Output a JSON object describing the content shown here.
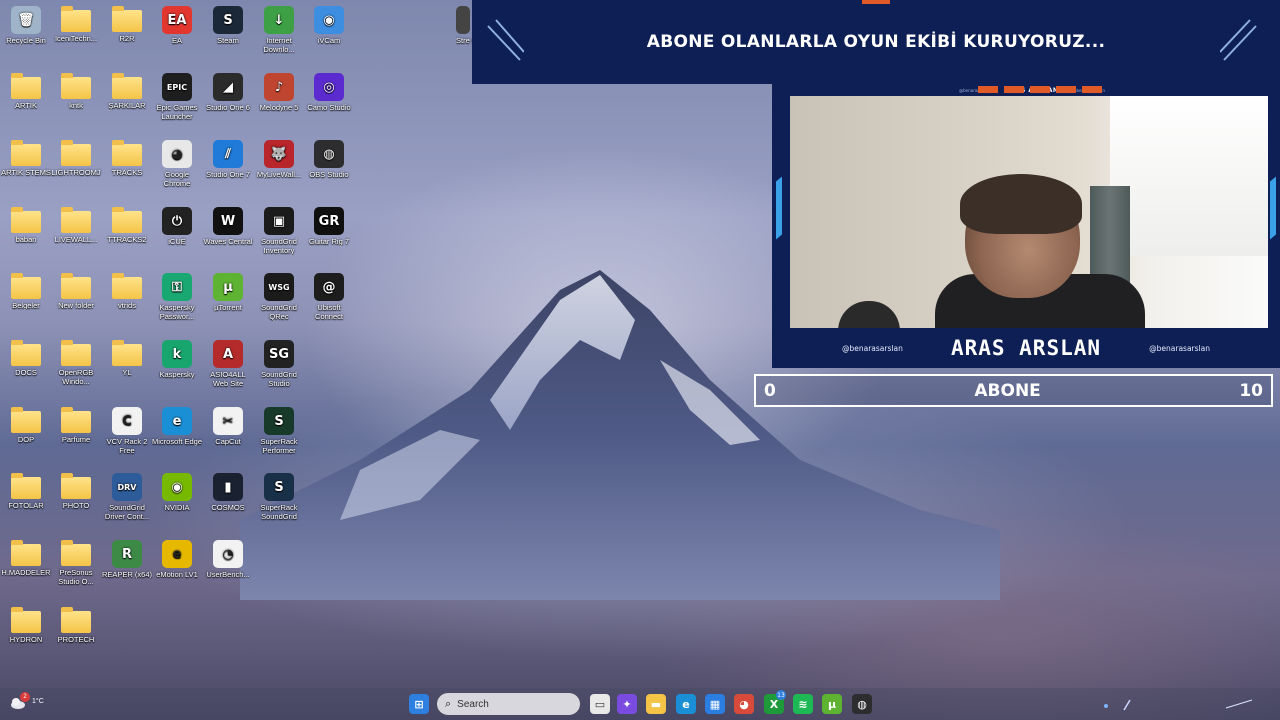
{
  "desktop": {
    "icons": [
      {
        "label": "Recycle Bin",
        "icon": "recycle-bin-icon",
        "color": "#9fb4c8",
        "glyph": "🗑",
        "col": 0,
        "row": 0
      },
      {
        "label": "IceniTechn...",
        "icon": "folder-icon",
        "folder": true,
        "col": 1,
        "row": 0
      },
      {
        "label": "R2R",
        "icon": "folder-icon",
        "folder": true,
        "col": 2,
        "row": 0
      },
      {
        "label": "EA",
        "icon": "ea-icon",
        "color": "#e2372f",
        "glyph": "EA",
        "col": 3,
        "row": 0
      },
      {
        "label": "Steam",
        "icon": "steam-icon",
        "color": "#1b2838",
        "glyph": "S",
        "col": 4,
        "row": 0
      },
      {
        "label": "Internet Downlo...",
        "icon": "internet-download-manager-icon",
        "color": "#3ea045",
        "glyph": "↓",
        "col": 5,
        "row": 0
      },
      {
        "label": "iVCam",
        "icon": "ivcam-icon",
        "color": "#3d8de0",
        "glyph": "◉",
        "col": 6,
        "row": 0
      },
      {
        "label": "ARTIK",
        "icon": "folder-icon",
        "folder": true,
        "col": 0,
        "row": 1
      },
      {
        "label": "kntk",
        "icon": "folder-icon",
        "folder": true,
        "col": 1,
        "row": 1
      },
      {
        "label": "ŞARKILAR",
        "icon": "folder-icon",
        "folder": true,
        "col": 2,
        "row": 1
      },
      {
        "label": "Epic Games Launcher",
        "icon": "epic-games-icon",
        "color": "#1e1e1e",
        "glyph": "EPIC",
        "col": 3,
        "row": 1
      },
      {
        "label": "Studio One 6",
        "icon": "studio-one-icon",
        "color": "#2b2b2b",
        "glyph": "◢",
        "col": 4,
        "row": 1
      },
      {
        "label": "Melodyne 5",
        "icon": "melodyne-icon",
        "color": "#c04530",
        "glyph": "♪",
        "col": 5,
        "row": 1
      },
      {
        "label": "Camo Studio",
        "icon": "camo-studio-icon",
        "color": "#5b2bd0",
        "glyph": "◎",
        "col": 6,
        "row": 1
      },
      {
        "label": "ARTIK STEMS",
        "icon": "folder-icon",
        "folder": true,
        "col": 0,
        "row": 2
      },
      {
        "label": "LIGHTROOMJ",
        "icon": "folder-icon",
        "folder": true,
        "col": 1,
        "row": 2
      },
      {
        "label": "TRACKS",
        "icon": "folder-icon",
        "folder": true,
        "col": 2,
        "row": 2
      },
      {
        "label": "Google Chrome",
        "icon": "chrome-icon",
        "color": "#e8e8e8",
        "glyph": "◕",
        "col": 3,
        "row": 2
      },
      {
        "label": "Studio One 7",
        "icon": "studio-one-7-icon",
        "color": "#1f7ad8",
        "glyph": "⫽",
        "col": 4,
        "row": 2
      },
      {
        "label": "MyLiveWall...",
        "icon": "mylivewallpaper-icon",
        "color": "#b8252a",
        "glyph": "🐺",
        "col": 5,
        "row": 2
      },
      {
        "label": "OBS Studio",
        "icon": "obs-icon",
        "color": "#2d2d30",
        "glyph": "◍",
        "col": 6,
        "row": 2
      },
      {
        "label": "baban",
        "icon": "folder-icon",
        "folder": true,
        "col": 0,
        "row": 3
      },
      {
        "label": "LIVEWALL...",
        "icon": "folder-icon",
        "folder": true,
        "col": 1,
        "row": 3
      },
      {
        "label": "TTRACKS2",
        "icon": "folder-icon",
        "folder": true,
        "col": 2,
        "row": 3
      },
      {
        "label": "iCUE",
        "icon": "icue-icon",
        "color": "#222222",
        "glyph": "⏻",
        "col": 3,
        "row": 3
      },
      {
        "label": "Waves Central",
        "icon": "waves-central-icon",
        "color": "#111111",
        "glyph": "W",
        "col": 4,
        "row": 3
      },
      {
        "label": "SoundGrid Inventory",
        "icon": "soundgrid-inventory-icon",
        "color": "#1b1b1b",
        "glyph": "▣",
        "col": 5,
        "row": 3
      },
      {
        "label": "Guitar Rig 7",
        "icon": "guitar-rig-icon",
        "color": "#101010",
        "glyph": "GR",
        "col": 6,
        "row": 3
      },
      {
        "label": "Belgeler",
        "icon": "folder-icon",
        "folder": true,
        "col": 0,
        "row": 4
      },
      {
        "label": "New folder",
        "icon": "folder-icon",
        "folder": true,
        "col": 1,
        "row": 4
      },
      {
        "label": "vtrids",
        "icon": "folder-icon",
        "folder": true,
        "col": 2,
        "row": 4
      },
      {
        "label": "Kaspersky Passwor...",
        "icon": "kaspersky-password-icon",
        "color": "#1aa872",
        "glyph": "⚿",
        "col": 3,
        "row": 4
      },
      {
        "label": "µTorrent",
        "icon": "utorrent-icon",
        "color": "#5fb332",
        "glyph": "µ",
        "col": 4,
        "row": 4
      },
      {
        "label": "SoundGrid QRec",
        "icon": "soundgrid-qrec-icon",
        "color": "#1b1b1b",
        "glyph": "WSG",
        "col": 5,
        "row": 4
      },
      {
        "label": "Ubisoft Connect",
        "icon": "ubisoft-icon",
        "color": "#1d1d1d",
        "glyph": "@",
        "col": 6,
        "row": 4
      },
      {
        "label": "DOCS",
        "icon": "folder-icon",
        "folder": true,
        "col": 0,
        "row": 5
      },
      {
        "label": "OpenRGB Windo...",
        "icon": "folder-icon",
        "folder": true,
        "col": 1,
        "row": 5
      },
      {
        "label": "YL",
        "icon": "folder-icon",
        "folder": true,
        "col": 2,
        "row": 5
      },
      {
        "label": "Kaspersky",
        "icon": "kaspersky-icon",
        "color": "#18a66e",
        "glyph": "k",
        "col": 3,
        "row": 5
      },
      {
        "label": "ASIO4ALL Web Site",
        "icon": "asio4all-icon",
        "color": "#b52a2a",
        "glyph": "A",
        "col": 4,
        "row": 5
      },
      {
        "label": "SoundGrid Studio",
        "icon": "soundgrid-studio-icon",
        "color": "#222222",
        "glyph": "SG",
        "col": 5,
        "row": 5
      },
      {
        "label": "DOP",
        "icon": "folder-icon",
        "folder": true,
        "col": 0,
        "row": 6
      },
      {
        "label": "Parfume",
        "icon": "folder-icon",
        "folder": true,
        "col": 1,
        "row": 6
      },
      {
        "label": "VCV Rack 2 Free",
        "icon": "vcv-rack-icon",
        "color": "#f2f2f2",
        "glyph": "C",
        "col": 2,
        "row": 6
      },
      {
        "label": "Microsoft Edge",
        "icon": "edge-icon",
        "color": "#1b8fd6",
        "glyph": "e",
        "col": 3,
        "row": 6
      },
      {
        "label": "CapCut",
        "icon": "capcut-icon",
        "color": "#f2f2f2",
        "glyph": "✂",
        "col": 4,
        "row": 6
      },
      {
        "label": "SuperRack Performer",
        "icon": "superrack-performer-icon",
        "color": "#183a2a",
        "glyph": "S",
        "col": 5,
        "row": 6
      },
      {
        "label": "FOTOLAR",
        "icon": "folder-icon",
        "folder": true,
        "col": 0,
        "row": 7
      },
      {
        "label": "PHOTO",
        "icon": "folder-icon",
        "folder": true,
        "col": 1,
        "row": 7
      },
      {
        "label": "SoundGrid Driver Cont...",
        "icon": "soundgrid-driver-icon",
        "color": "#2e5c9a",
        "glyph": "DRV",
        "col": 2,
        "row": 7
      },
      {
        "label": "NVIDIA",
        "icon": "nvidia-icon",
        "color": "#76b900",
        "glyph": "◉",
        "col": 3,
        "row": 7
      },
      {
        "label": "COSMOS",
        "icon": "cosmos-icon",
        "color": "#1a2232",
        "glyph": "▮",
        "col": 4,
        "row": 7
      },
      {
        "label": "SuperRack SoundGrid",
        "icon": "superrack-soundgrid-icon",
        "color": "#183048",
        "glyph": "S",
        "col": 5,
        "row": 7
      },
      {
        "label": "H.MADDELER",
        "icon": "folder-icon",
        "folder": true,
        "col": 0,
        "row": 8
      },
      {
        "label": "PreSonus Studio O...",
        "icon": "folder-icon",
        "folder": true,
        "col": 1,
        "row": 8
      },
      {
        "label": "REAPER (x64)",
        "icon": "reaper-icon",
        "color": "#3c8a46",
        "glyph": "R",
        "col": 2,
        "row": 8
      },
      {
        "label": "eMotion LV1",
        "icon": "emotion-lv1-icon",
        "color": "#e6b800",
        "glyph": "e",
        "col": 3,
        "row": 8
      },
      {
        "label": "UserBench...",
        "icon": "userbenchmark-icon",
        "color": "#f2f2f2",
        "glyph": "◔",
        "col": 4,
        "row": 8
      },
      {
        "label": "HYDRON",
        "icon": "folder-icon",
        "folder": true,
        "col": 0,
        "row": 9
      },
      {
        "label": "PROTECH",
        "icon": "folder-icon",
        "folder": true,
        "col": 1,
        "row": 9
      }
    ],
    "partial_icon": {
      "label": "Stre Gri",
      "icon": "partial-app-icon",
      "color": "#444444"
    }
  },
  "overlay": {
    "banner_title": "ABONE OLANLARLA OYUN EKİBİ KURUYORUZ...",
    "cam_header_name": "ARAS ARSLAN",
    "cam_header_small_left": "@benarasarslan",
    "cam_header_small_right": "@benarasarslan",
    "streamer_name": "ARAS ARSLAN",
    "handle_left": "@benarasarslan",
    "handle_right": "@benarasarslan",
    "colors": {
      "navy": "#0e1f55",
      "accent_orange": "#e05a28",
      "accent_blue": "#3aa0e8"
    }
  },
  "subscriber_goal": {
    "label": "ABONE",
    "current": "0",
    "target": "10",
    "progress_fraction": 0.0
  },
  "taskbar": {
    "weather_temp": "1°C",
    "weather_badge": "2",
    "search_placeholder": "Search",
    "apps": [
      {
        "icon": "windows-start-icon",
        "color": "#2d7fe0",
        "glyph": "⊞"
      },
      {
        "icon": "task-view-icon",
        "color": "#e8e8e8",
        "glyph": "▭"
      },
      {
        "icon": "copilot-icon",
        "color": "#7a4be0",
        "glyph": "✦"
      },
      {
        "icon": "file-explorer-icon",
        "color": "#f4c447",
        "glyph": "▬"
      },
      {
        "icon": "edge-icon",
        "color": "#1b8fd6",
        "glyph": "e"
      },
      {
        "icon": "microsoft-store-icon",
        "color": "#2a7de1",
        "glyph": "▦"
      },
      {
        "icon": "chrome-icon",
        "color": "#d84a3a",
        "glyph": "◕"
      },
      {
        "icon": "xbox-icon",
        "color": "#1f9a3a",
        "glyph": "X",
        "badge": "13"
      },
      {
        "icon": "spotify-icon",
        "color": "#1db954",
        "glyph": "≋"
      },
      {
        "icon": "utorrent-icon",
        "color": "#5fb332",
        "glyph": "µ"
      },
      {
        "icon": "obs-icon",
        "color": "#2d2d30",
        "glyph": "◍"
      }
    ]
  }
}
